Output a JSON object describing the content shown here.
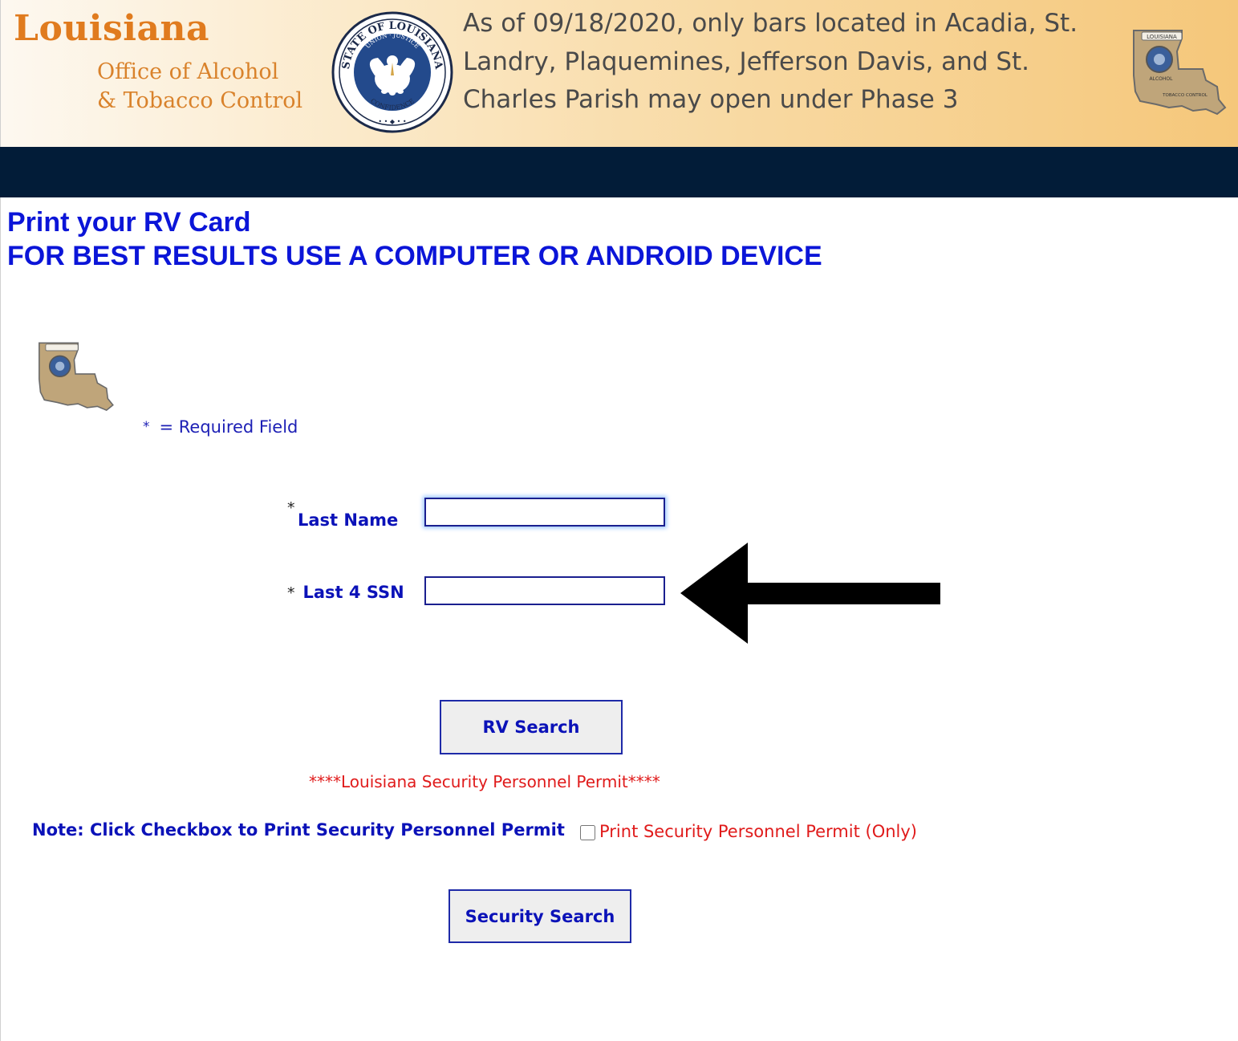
{
  "header": {
    "brand_title": "Louisiana",
    "brand_line1": "Office of Alcohol",
    "brand_line2": "& Tobacco Control",
    "seal_text_top": "STATE OF LOUISIANA",
    "seal_text_motto": "UNION · JUSTICE",
    "seal_text_bottom": "CONFIDENCE",
    "notice": "As of 09/18/2020, only bars located in Acadia, St. Landry, Plaquemines, Jefferson Davis, and St. Charles Parish may open under Phase 3",
    "map_logo_text_top": "LOUISIANA",
    "map_logo_text_mid": "ALCOHOL",
    "map_logo_text_bot": "TOBACCO CONTROL"
  },
  "page": {
    "heading_line1": "Print your RV Card",
    "heading_line2": "FOR BEST RESULTS USE A COMPUTER OR ANDROID DEVICE",
    "required_star": "*",
    "required_text": "= Required Field"
  },
  "form": {
    "last_name_star": "*",
    "last_name_label": "Last Name",
    "last_name_value": "",
    "ssn_star": "*",
    "ssn_label": "Last 4 SSN",
    "ssn_value": "",
    "rv_search_button": "RV Search",
    "security_permit_title": "****Louisiana Security Personnel Permit****",
    "note_text": "Note: Click Checkbox to Print Security Personnel Permit",
    "checkbox_checked": false,
    "checkbox_label": "Print Security Personnel Permit (Only)",
    "security_search_button": "Security Search"
  },
  "colors": {
    "heading_blue": "#0b15d8",
    "label_blue": "#0b12b8",
    "permit_red": "#e01b1b",
    "navbar": "#021c38",
    "brand_orange": "#e07b1e"
  },
  "icons": {
    "seal": "state-seal-icon",
    "map_logo": "louisiana-map-logo-icon",
    "arrow": "arrow-left-icon"
  }
}
